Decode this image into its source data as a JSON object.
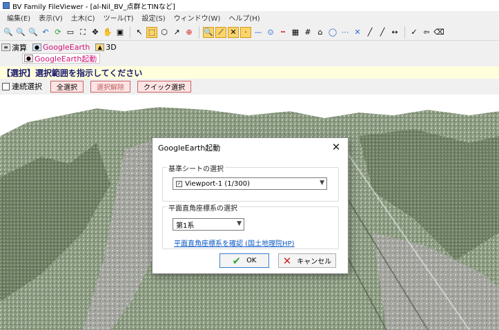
{
  "window": {
    "title": "BV Family FileViewer - [al-Nil_BV_点群とTINなど]"
  },
  "menu": [
    "編集(E)",
    "表示(V)",
    "土木(C)",
    "ツール(T)",
    "設定(S)",
    "ウィンドウ(W)",
    "ヘルプ(H)"
  ],
  "subtabs": {
    "tab1": "演算",
    "tab2": "GoogleEarth",
    "tab3": "3D",
    "tab4": "GoogleEarth起動"
  },
  "instruction": "【選択】選択範囲を指示してください",
  "selection": {
    "continuous_label": "連続選択",
    "select_all": "全選択",
    "deselect": "選択解除",
    "quick_select": "クイック選択"
  },
  "dialog": {
    "title": "GoogleEarth起動",
    "close": "✕",
    "group1_label": "基準シートの選択",
    "viewport_value": "Viewport-1 (1/300)",
    "group2_label": "平面直角座標系の選択",
    "coord_value": "第1系",
    "link_text": "平面直角座標系を確認 (国土地理院HP)",
    "ok_label": "OK",
    "cancel_label": "キャンセル"
  },
  "colors": {
    "accent": "#d0147a",
    "link": "#0b58c4",
    "ok_check": "#3aa63a",
    "cancel_x": "#d02020"
  }
}
